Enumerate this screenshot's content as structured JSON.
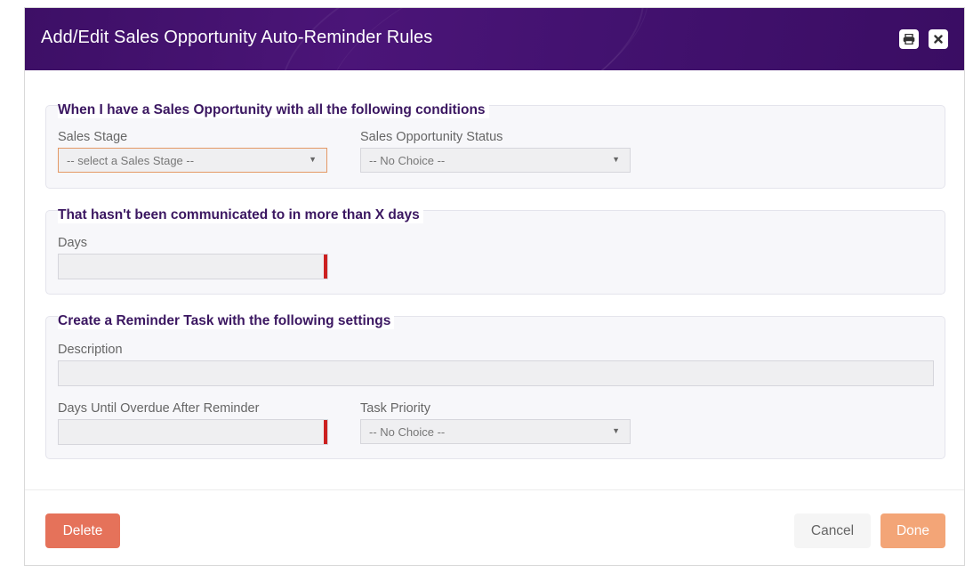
{
  "dialog": {
    "title": "Add/Edit Sales Opportunity Auto-Reminder Rules"
  },
  "header_icons": {
    "print": "print-icon",
    "close": "close-icon"
  },
  "conditions": {
    "title": "When I have a Sales Opportunity with all the following conditions",
    "sales_stage_label": "Sales Stage",
    "sales_stage_value": "-- select a Sales Stage --",
    "status_label": "Sales Opportunity Status",
    "status_value": "-- No Choice --"
  },
  "communication": {
    "title": "That hasn't been communicated to in more than X days",
    "days_label": "Days",
    "days_value": ""
  },
  "reminder": {
    "title": "Create a Reminder Task with the following settings",
    "description_label": "Description",
    "description_value": "",
    "overdue_label": "Days Until Overdue After Reminder",
    "overdue_value": "",
    "priority_label": "Task Priority",
    "priority_value": "-- No Choice --"
  },
  "footer": {
    "delete_label": "Delete",
    "cancel_label": "Cancel",
    "done_label": "Done"
  },
  "colors": {
    "header": "#3d0f66",
    "section_title": "#3b1761",
    "delete": "#e5725a",
    "done": "#f3a577",
    "required_marker": "#cc1f1f"
  }
}
